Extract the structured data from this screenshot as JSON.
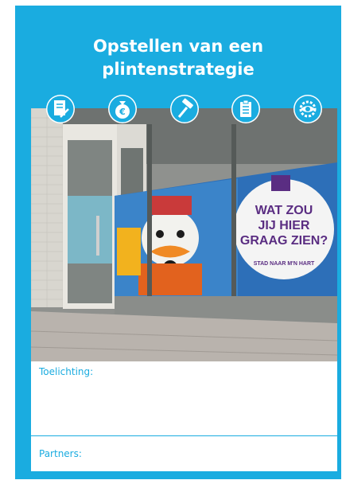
{
  "title": {
    "line1": "Opstellen van een",
    "line2": "plintenstrategie"
  },
  "icons": [
    {
      "name": "document-edit-icon"
    },
    {
      "name": "money-bag-euro-icon"
    },
    {
      "name": "hammer-icon"
    },
    {
      "name": "clipboard-list-icon"
    },
    {
      "name": "eye-gear-icon"
    }
  ],
  "photo": {
    "poster_heading": "WAT ZOU JIJ HIER GRAAG ZIEN?",
    "poster_line1": "WAT ZOU",
    "poster_line2": "JIJ HIER",
    "poster_line3": "GRAAG ZIEN?",
    "poster_tagline": "STAD NAAR M'N HART"
  },
  "fields": {
    "toelichting_label": "Toelichting:",
    "partners_label": "Partners:"
  },
  "colors": {
    "accent": "#1aace0",
    "poster_purple": "#5a2d82"
  }
}
